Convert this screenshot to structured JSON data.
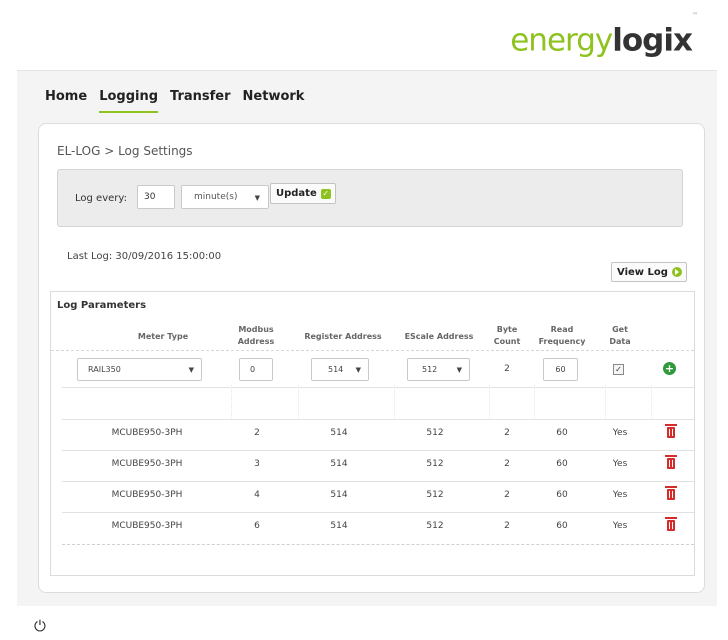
{
  "brand": {
    "energy": "energy",
    "logix": "logix",
    "tm": "™"
  },
  "nav": [
    {
      "label": "Home",
      "active": false
    },
    {
      "label": "Logging",
      "active": true
    },
    {
      "label": "Transfer",
      "active": false
    },
    {
      "label": "Network",
      "active": false
    }
  ],
  "breadcrumb": "EL-LOG > Log Settings",
  "log_every": {
    "label": "Log every:",
    "value": "30",
    "unit": "minute(s)",
    "update_label": "Update"
  },
  "last_log": "Last Log: 30/09/2016 15:00:00",
  "view_log_label": "View Log",
  "params": {
    "title": "Log Parameters",
    "headers": {
      "meter_type": "Meter Type",
      "modbus_address": "Modbus Address",
      "register_address": "Register Address",
      "escale_address": "EScale Address",
      "byte_count": "Byte Count",
      "read_frequency": "Read Frequency",
      "get_data": "Get Data"
    },
    "new_row": {
      "meter_type": "RAIL350",
      "modbus_address": "0",
      "register_address": "514",
      "escale_address": "512",
      "byte_count": "2",
      "read_frequency": "60",
      "get_data": true
    },
    "rows": [
      {
        "meter_type": "MCUBE950-3PH",
        "modbus_address": "2",
        "register_address": "514",
        "escale_address": "512",
        "byte_count": "2",
        "read_frequency": "60",
        "get_data": "Yes"
      },
      {
        "meter_type": "MCUBE950-3PH",
        "modbus_address": "3",
        "register_address": "514",
        "escale_address": "512",
        "byte_count": "2",
        "read_frequency": "60",
        "get_data": "Yes"
      },
      {
        "meter_type": "MCUBE950-3PH",
        "modbus_address": "4",
        "register_address": "514",
        "escale_address": "512",
        "byte_count": "2",
        "read_frequency": "60",
        "get_data": "Yes"
      },
      {
        "meter_type": "MCUBE950-3PH",
        "modbus_address": "6",
        "register_address": "514",
        "escale_address": "512",
        "byte_count": "2",
        "read_frequency": "60",
        "get_data": "Yes"
      }
    ]
  },
  "icons": {
    "update": "check-icon",
    "view_log": "arrow-circle-icon",
    "add": "add-icon",
    "delete": "trash-icon",
    "power": "power-icon"
  },
  "colors": {
    "accent": "#8ec21f",
    "add": "#2e9a3c",
    "delete": "#d52b2b"
  }
}
